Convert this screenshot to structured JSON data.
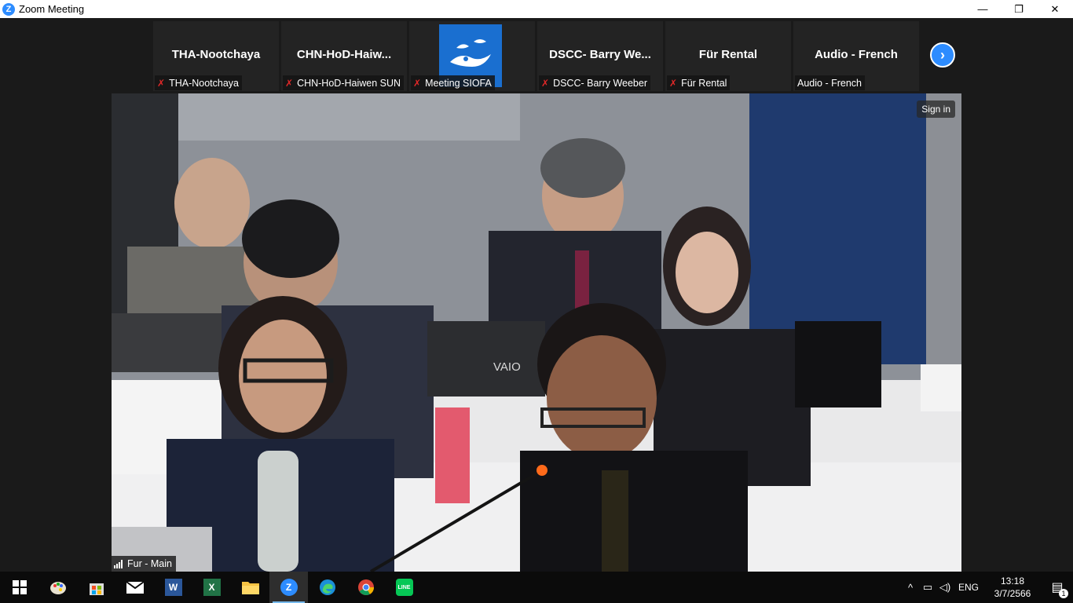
{
  "window": {
    "title": "Zoom Meeting",
    "logo_letter": "Z"
  },
  "controls": {
    "minimize": "—",
    "restore": "❐",
    "close": "✕"
  },
  "gallery": {
    "tiles": [
      {
        "big_name": "THA-Nootchaya",
        "name": "THA-Nootchaya",
        "muted": true
      },
      {
        "big_name": "CHN-HoD-Haiw...",
        "name": "CHN-HoD-Haiwen SUN",
        "muted": true
      },
      {
        "big_name": "",
        "name": "Meeting SIOFA",
        "muted": true
      },
      {
        "big_name": "DSCC- Barry We...",
        "name": "DSCC- Barry Weeber",
        "muted": true
      },
      {
        "big_name": "Für Rental",
        "name": "Für Rental",
        "muted": true
      },
      {
        "big_name": "Audio - French",
        "name": "Audio - French",
        "muted": false
      }
    ],
    "next_icon": "chevron-right-icon"
  },
  "main_video": {
    "sign_in": "Sign in",
    "label": "Fur - Main",
    "laptop_brand": "VAIO"
  },
  "taskbar": {
    "apps": [
      {
        "name": "start-button",
        "glyph": ""
      },
      {
        "name": "paint-app",
        "glyph": ""
      },
      {
        "name": "store-app",
        "glyph": ""
      },
      {
        "name": "mail-app",
        "glyph": ""
      },
      {
        "name": "word-app",
        "glyph": "W"
      },
      {
        "name": "excel-app",
        "glyph": "X"
      },
      {
        "name": "explorer-app",
        "glyph": ""
      },
      {
        "name": "zoom-app",
        "glyph": "Z"
      },
      {
        "name": "edge-app",
        "glyph": ""
      },
      {
        "name": "chrome-app",
        "glyph": ""
      },
      {
        "name": "line-app",
        "glyph": "LINE"
      }
    ],
    "language": "ENG",
    "time": "13:18",
    "date": "3/7/2566",
    "notification_count": "1"
  }
}
